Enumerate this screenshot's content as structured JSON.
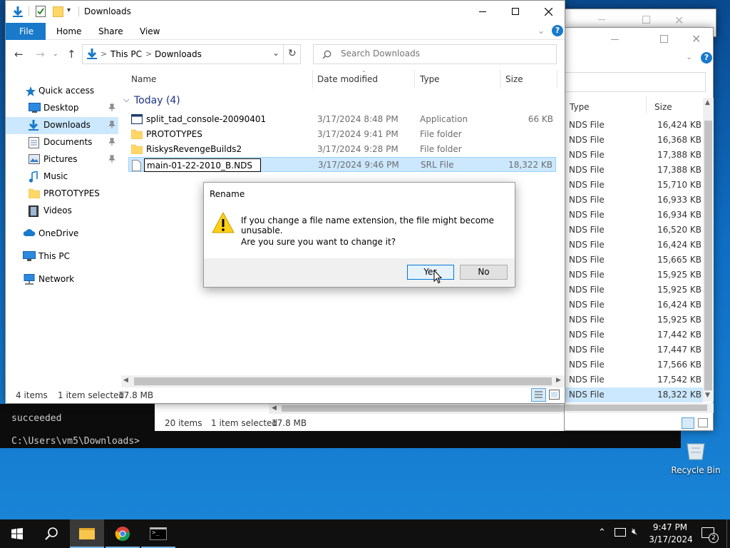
{
  "desktop": {
    "recycle_bin_label": "Recycle Bin"
  },
  "console": {
    "line1": "succeeded",
    "line2": "C:\\Users\\vm5\\Downloads>"
  },
  "back_explorer": {
    "columns": {
      "type": "Type",
      "size": "Size"
    },
    "rows": [
      {
        "type": "NDS File",
        "size": "16,424 KB"
      },
      {
        "type": "NDS File",
        "size": "16,368 KB"
      },
      {
        "type": "NDS File",
        "size": "17,388 KB"
      },
      {
        "type": "NDS File",
        "size": "17,388 KB"
      },
      {
        "type": "NDS File",
        "size": "15,710 KB"
      },
      {
        "type": "NDS File",
        "size": "16,933 KB"
      },
      {
        "type": "NDS File",
        "size": "16,934 KB"
      },
      {
        "type": "NDS File",
        "size": "16,520 KB"
      },
      {
        "type": "NDS File",
        "size": "16,424 KB"
      },
      {
        "type": "NDS File",
        "size": "15,665 KB"
      },
      {
        "type": "NDS File",
        "size": "15,925 KB"
      },
      {
        "type": "NDS File",
        "size": "15,925 KB"
      },
      {
        "type": "NDS File",
        "size": "16,424 KB"
      },
      {
        "type": "NDS File",
        "size": "15,925 KB"
      },
      {
        "type": "NDS File",
        "size": "17,442 KB"
      },
      {
        "type": "NDS File",
        "size": "17,447 KB"
      },
      {
        "type": "NDS File",
        "size": "17,566 KB"
      },
      {
        "type": "NDS File",
        "size": "17,542 KB"
      },
      {
        "type": "NDS File",
        "size": "18,322 KB"
      }
    ],
    "status": {
      "items": "20 items",
      "selected": "1 item selected",
      "size": "17.8 MB"
    }
  },
  "explorer": {
    "title": "Downloads",
    "ribbon": {
      "file": "File",
      "home": "Home",
      "share": "Share",
      "view": "View"
    },
    "breadcrumb": {
      "root": "This PC",
      "sep": ">",
      "folder": "Downloads"
    },
    "search_placeholder": "Search Downloads",
    "columns": {
      "name": "Name",
      "date": "Date modified",
      "type": "Type",
      "size": "Size"
    },
    "group": "Today (4)",
    "files": [
      {
        "name": "split_tad_console-20090401",
        "date": "3/17/2024 8:48 PM",
        "type": "Application",
        "size": "66 KB",
        "icon": "application-icon"
      },
      {
        "name": "PROTOTYPES",
        "date": "3/17/2024 9:41 PM",
        "type": "File folder",
        "size": "",
        "icon": "folder-icon"
      },
      {
        "name": "RiskysRevengeBuilds2",
        "date": "3/17/2024 9:28 PM",
        "type": "File folder",
        "size": "",
        "icon": "folder-icon"
      },
      {
        "name": "main-01-22-2010_B.NDS",
        "date": "3/17/2024 9:46 PM",
        "type": "SRL File",
        "size": "18,322 KB",
        "icon": "file-icon"
      }
    ],
    "sidebar": [
      {
        "label": "Quick access",
        "icon": "star-icon"
      },
      {
        "label": "Desktop",
        "icon": "desktop-icon"
      },
      {
        "label": "Downloads",
        "icon": "download-icon"
      },
      {
        "label": "Documents",
        "icon": "documents-icon"
      },
      {
        "label": "Pictures",
        "icon": "pictures-icon"
      },
      {
        "label": "Music",
        "icon": "music-icon"
      },
      {
        "label": "PROTOTYPES",
        "icon": "folder-icon"
      },
      {
        "label": "Videos",
        "icon": "videos-icon"
      },
      {
        "label": "OneDrive",
        "icon": "onedrive-icon"
      },
      {
        "label": "This PC",
        "icon": "computer-icon"
      },
      {
        "label": "Network",
        "icon": "network-icon"
      }
    ],
    "status": {
      "items": "4 items",
      "selected": "1 item selected",
      "size": "17.8 MB"
    }
  },
  "dialog": {
    "title": "Rename",
    "message": "If you change a file name extension, the file might become unusable.",
    "question": "Are you sure you want to change it?",
    "yes": "Yes",
    "no": "No"
  },
  "taskbar": {
    "time": "9:47 PM",
    "date": "3/17/2024",
    "notification_count": "2"
  },
  "colors": {
    "selection": "#cce8ff",
    "accent": "#0063b1",
    "taskbar": "#101010"
  }
}
